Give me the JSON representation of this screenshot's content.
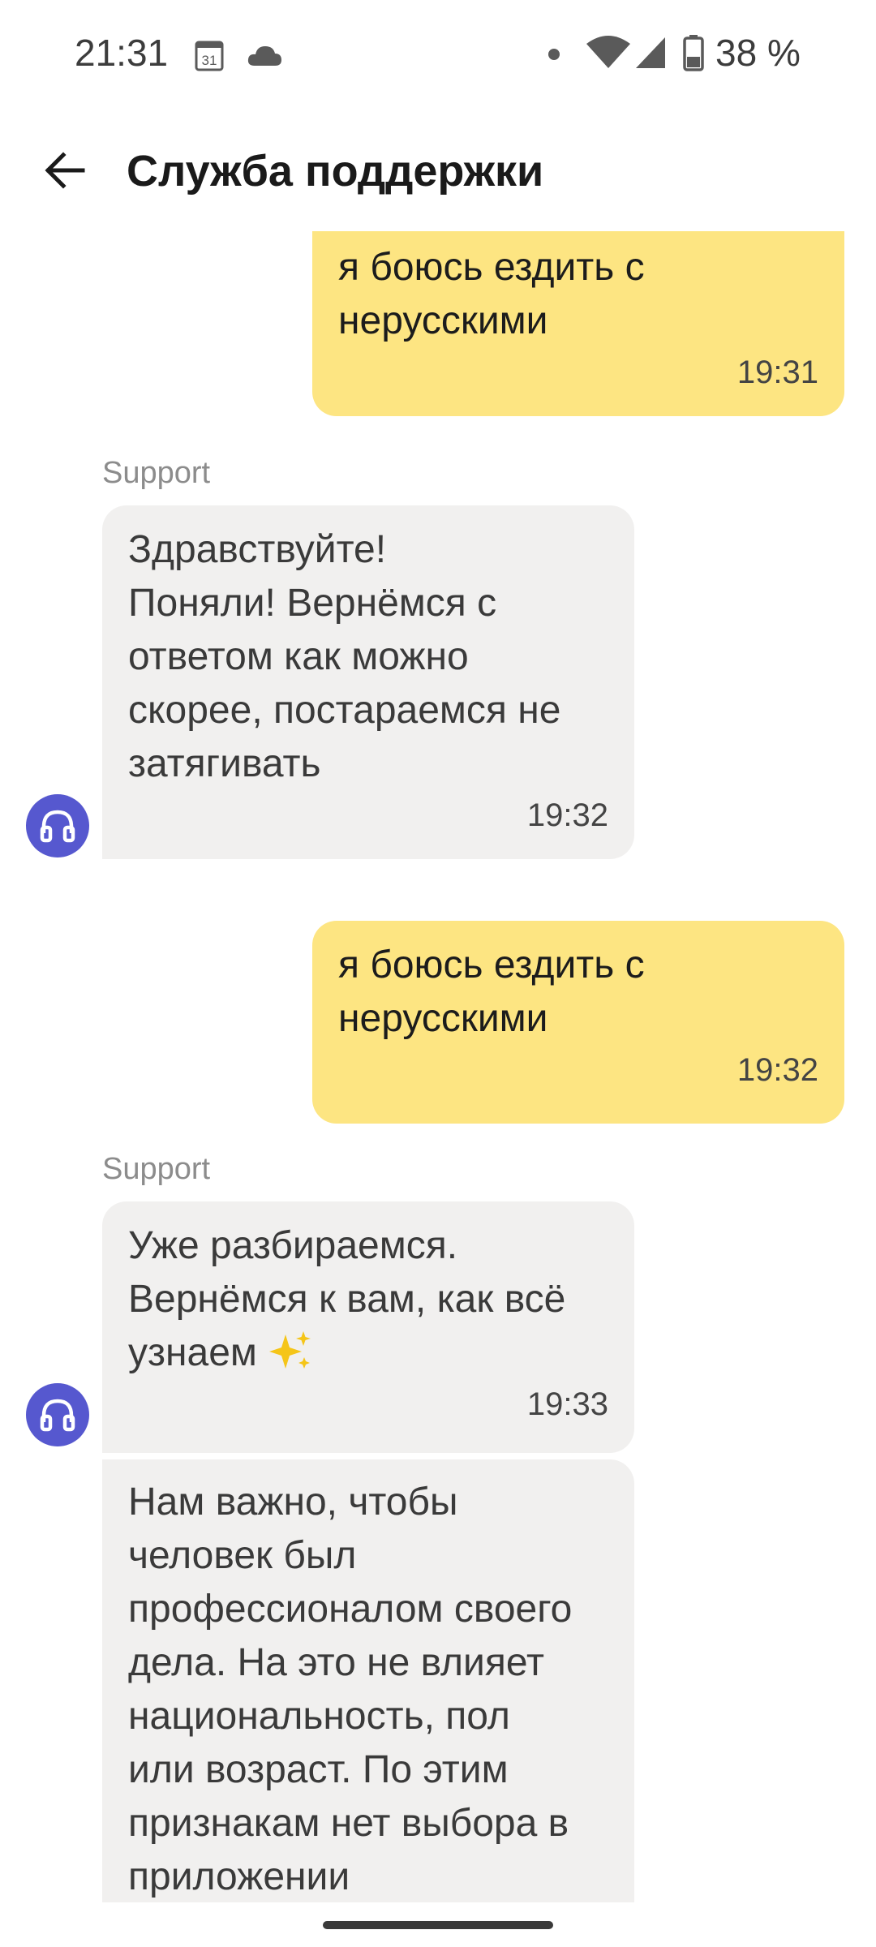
{
  "status_bar": {
    "time": "21:31",
    "calendar_day": "31",
    "battery": "38 %",
    "icons": [
      "calendar-icon",
      "cloud-icon",
      "notification-dot-icon",
      "wifi-icon",
      "signal-icon",
      "battery-icon"
    ]
  },
  "header": {
    "title": "Служба поддержки",
    "back_icon": "arrow-left-icon"
  },
  "colors": {
    "outgoing_bubble": "#fde582",
    "incoming_bubble": "#f1f0ef",
    "avatar": "#5658cf",
    "sender_label": "#8c8c8c"
  },
  "messages": [
    {
      "direction": "outgoing",
      "text": "я боюсь ездить с\nнерусскими",
      "time": "19:31"
    },
    {
      "direction": "incoming",
      "sender": "Support",
      "text": "Здравствуйте!\nПоняли! Вернёмся с\nответом как можно\nскорее, постараемся не\nзатягивать",
      "time": "19:32"
    },
    {
      "direction": "outgoing",
      "text": "я боюсь ездить с\nнерусскими",
      "time": "19:32"
    },
    {
      "direction": "incoming",
      "sender": "Support",
      "text": "Уже разбираемся.\nВернёмся к вам, как всё\nузнаем",
      "emoji": "sparkles-icon",
      "time": "19:33"
    },
    {
      "direction": "incoming",
      "text": "Нам важно, чтобы\nчеловек был\nпрофессионалом своего\nдела. На это не влияет\nнациональность, пол\nили возраст. По этим\nпризнакам нет выбора в\nприложении"
    }
  ]
}
